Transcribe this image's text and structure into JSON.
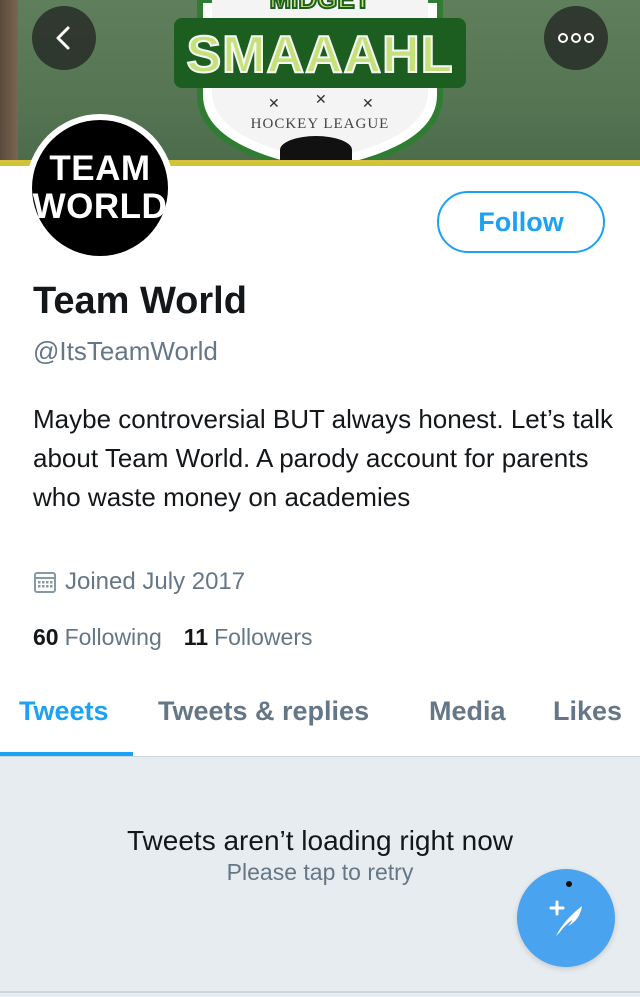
{
  "banner": {
    "logo_title": "SMAAAHL",
    "logo_top": "MIDGET",
    "logo_sub": "HOCKEY LEAGUE"
  },
  "header": {
    "back_icon": "chevron-left-icon",
    "more_icon": "more-dots-icon"
  },
  "avatar": {
    "line1": "TEAM",
    "line2": "WORLD"
  },
  "profile": {
    "follow_label": "Follow",
    "name": "Team World",
    "handle": "@ItsTeamWorld",
    "bio": "Maybe controversial BUT always honest. Let’s talk about Team World. A parody account for parents who waste money on academies",
    "joined": "Joined July 2017",
    "following_count": "60",
    "following_label": "Following",
    "followers_count": "11",
    "followers_label": "Followers"
  },
  "tabs": [
    {
      "label": "Tweets",
      "active": true
    },
    {
      "label": "Tweets & replies",
      "active": false
    },
    {
      "label": "Media",
      "active": false
    },
    {
      "label": "Likes",
      "active": false
    }
  ],
  "timeline": {
    "error_title": "Tweets aren’t loading right now",
    "error_subtitle": "Please tap to retry"
  },
  "compose": {
    "icon": "compose-tweet-icon"
  },
  "colors": {
    "accent": "#1da1f2",
    "muted": "#657786",
    "text": "#14171a",
    "timeline_bg": "#e6ecf0"
  }
}
